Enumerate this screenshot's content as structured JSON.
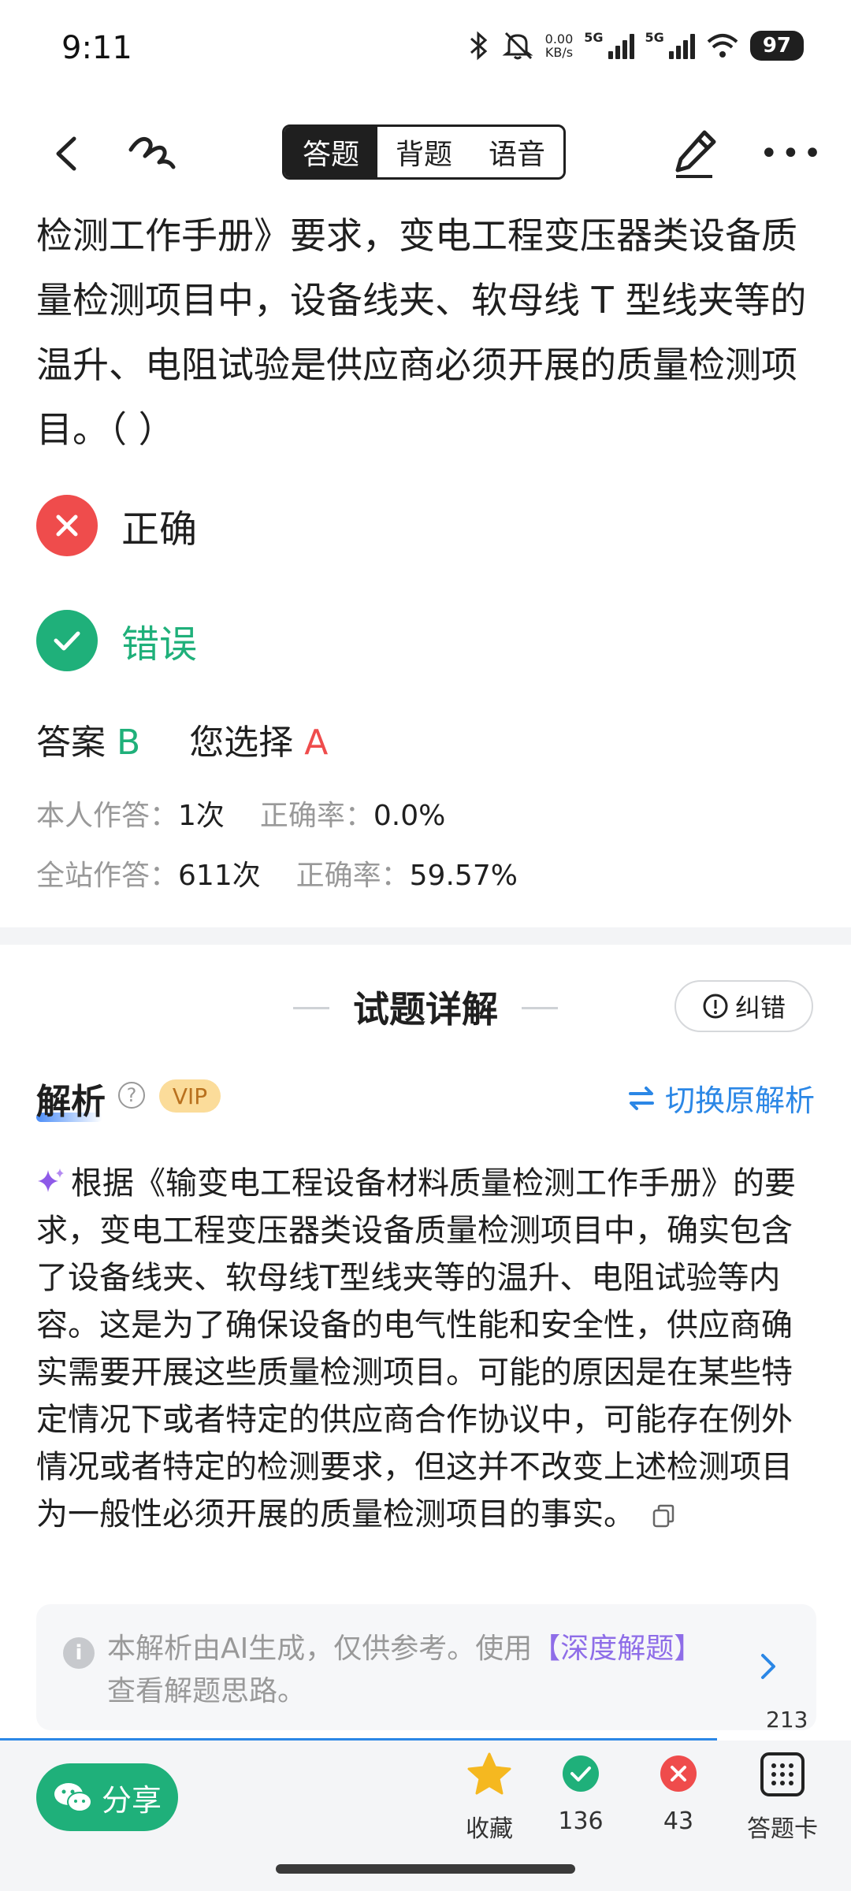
{
  "status_bar": {
    "time": "9:11",
    "net_speed_value": "0.00",
    "net_speed_unit": "KB/s",
    "network_1": "5G",
    "network_2": "5G",
    "battery": "97"
  },
  "toolbar": {
    "tabs": [
      {
        "label": "答题",
        "active": true
      },
      {
        "label": "背题",
        "active": false
      },
      {
        "label": "语音",
        "active": false
      }
    ]
  },
  "question": {
    "text": "检测工作手册》要求，变电工程变压器类设备质量检测项目中，设备线夹、软母线 T 型线夹等的温升、电阻试验是供应商必须开展的质量检测项目。（ ）"
  },
  "options": [
    {
      "label": "正确",
      "state": "wrong",
      "color": "#ef4c4c"
    },
    {
      "label": "错误",
      "state": "correct",
      "color": "#1fb07a"
    }
  ],
  "answer": {
    "answer_label": "答案",
    "answer_value": "B",
    "selected_label": "您选择",
    "selected_value": "A"
  },
  "stats": {
    "personal_label": "本人作答：",
    "personal_count": "1次",
    "personal_rate_label": "正确率：",
    "personal_rate": "0.0%",
    "site_label": "全站作答：",
    "site_count": "611次",
    "site_rate_label": "正确率：",
    "site_rate": "59.57%"
  },
  "detail": {
    "title": "试题详解",
    "correct_button": "纠错",
    "analysis_label": "解析",
    "vip": "VIP",
    "switch_label": "切换原解析",
    "analysis_text": "根据《输变电工程设备材料质量检测工作手册》的要求，变电工程变压器类设备质量检测项目中，确实包含了设备线夹、软母线T型线夹等的温升、电阻试验等内容。这是为了确保设备的电气性能和安全性，供应商确实需要开展这些质量检测项目。可能的原因是在某些特定情况下或者特定的供应商合作协议中，可能存在例外情况或者特定的检测要求，但这并不改变上述检测项目为一般性必须开展的质量检测项目的事实。",
    "ai_note_prefix": "本解析由AI生成，仅供参考。使用",
    "ai_note_link": "【深度解题】",
    "ai_note_suffix": "查看解题思路。",
    "count": "213"
  },
  "bottom_bar": {
    "share": "分享",
    "favorite": "收藏",
    "correct_count": "136",
    "wrong_count": "43",
    "answer_card": "答题卡"
  },
  "colors": {
    "accent_green": "#1fb07a",
    "accent_red": "#ef4c4c",
    "link_blue": "#2b87e6",
    "ai_purple": "#8e6de8"
  }
}
